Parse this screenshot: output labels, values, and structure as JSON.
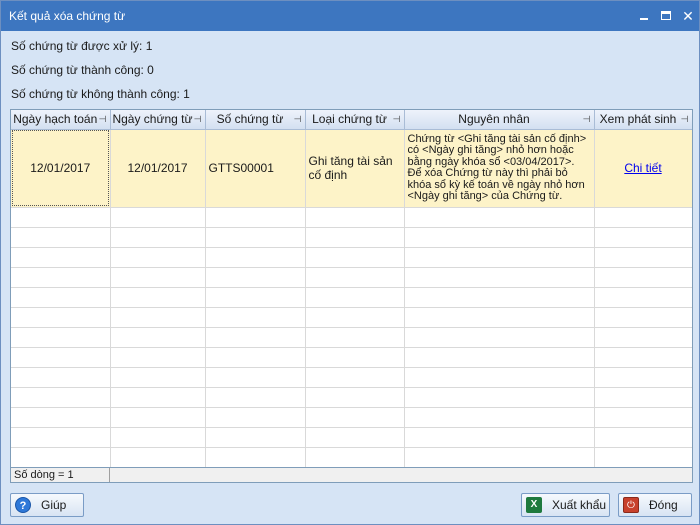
{
  "window": {
    "title": "Kết quả xóa chứng từ"
  },
  "summary": {
    "processed": "Số chứng từ được xử lý: 1",
    "success": "Số chứng từ thành công: 0",
    "failed": "Số chứng từ không thành công: 1"
  },
  "grid": {
    "columns": [
      "Ngày hạch toán",
      "Ngày chứng từ",
      "Số chứng từ",
      "Loại chứng từ",
      "Nguyên nhân",
      "Xem phát sinh"
    ],
    "rows": [
      {
        "posting_date": "12/01/2017",
        "voucher_date": "12/01/2017",
        "voucher_no": "GTTS00001",
        "voucher_type": "Ghi tăng tài sản cố định",
        "reason": "Chứng từ <Ghi tăng tài sản cố định> có <Ngày ghi tăng> nhỏ hơn hoặc bằng ngày khóa sổ <03/04/2017>. Để xóa Chứng từ này thì phải bỏ khóa sổ kỳ kế toán về ngày nhỏ hơn <Ngày ghi tăng> của Chứng từ.",
        "detail_link": "Chi tiết"
      }
    ],
    "row_count": "Số dòng = 1"
  },
  "buttons": {
    "help": "Giúp",
    "export": "Xuất khẩu",
    "close": "Đóng"
  },
  "icons": {
    "help": "help-icon",
    "export": "excel-icon",
    "close": "power-off-icon"
  },
  "colors": {
    "titlebar": "#3d76c0",
    "selected_row": "#fdf3c8",
    "window_bg": "#d6e4f5"
  }
}
